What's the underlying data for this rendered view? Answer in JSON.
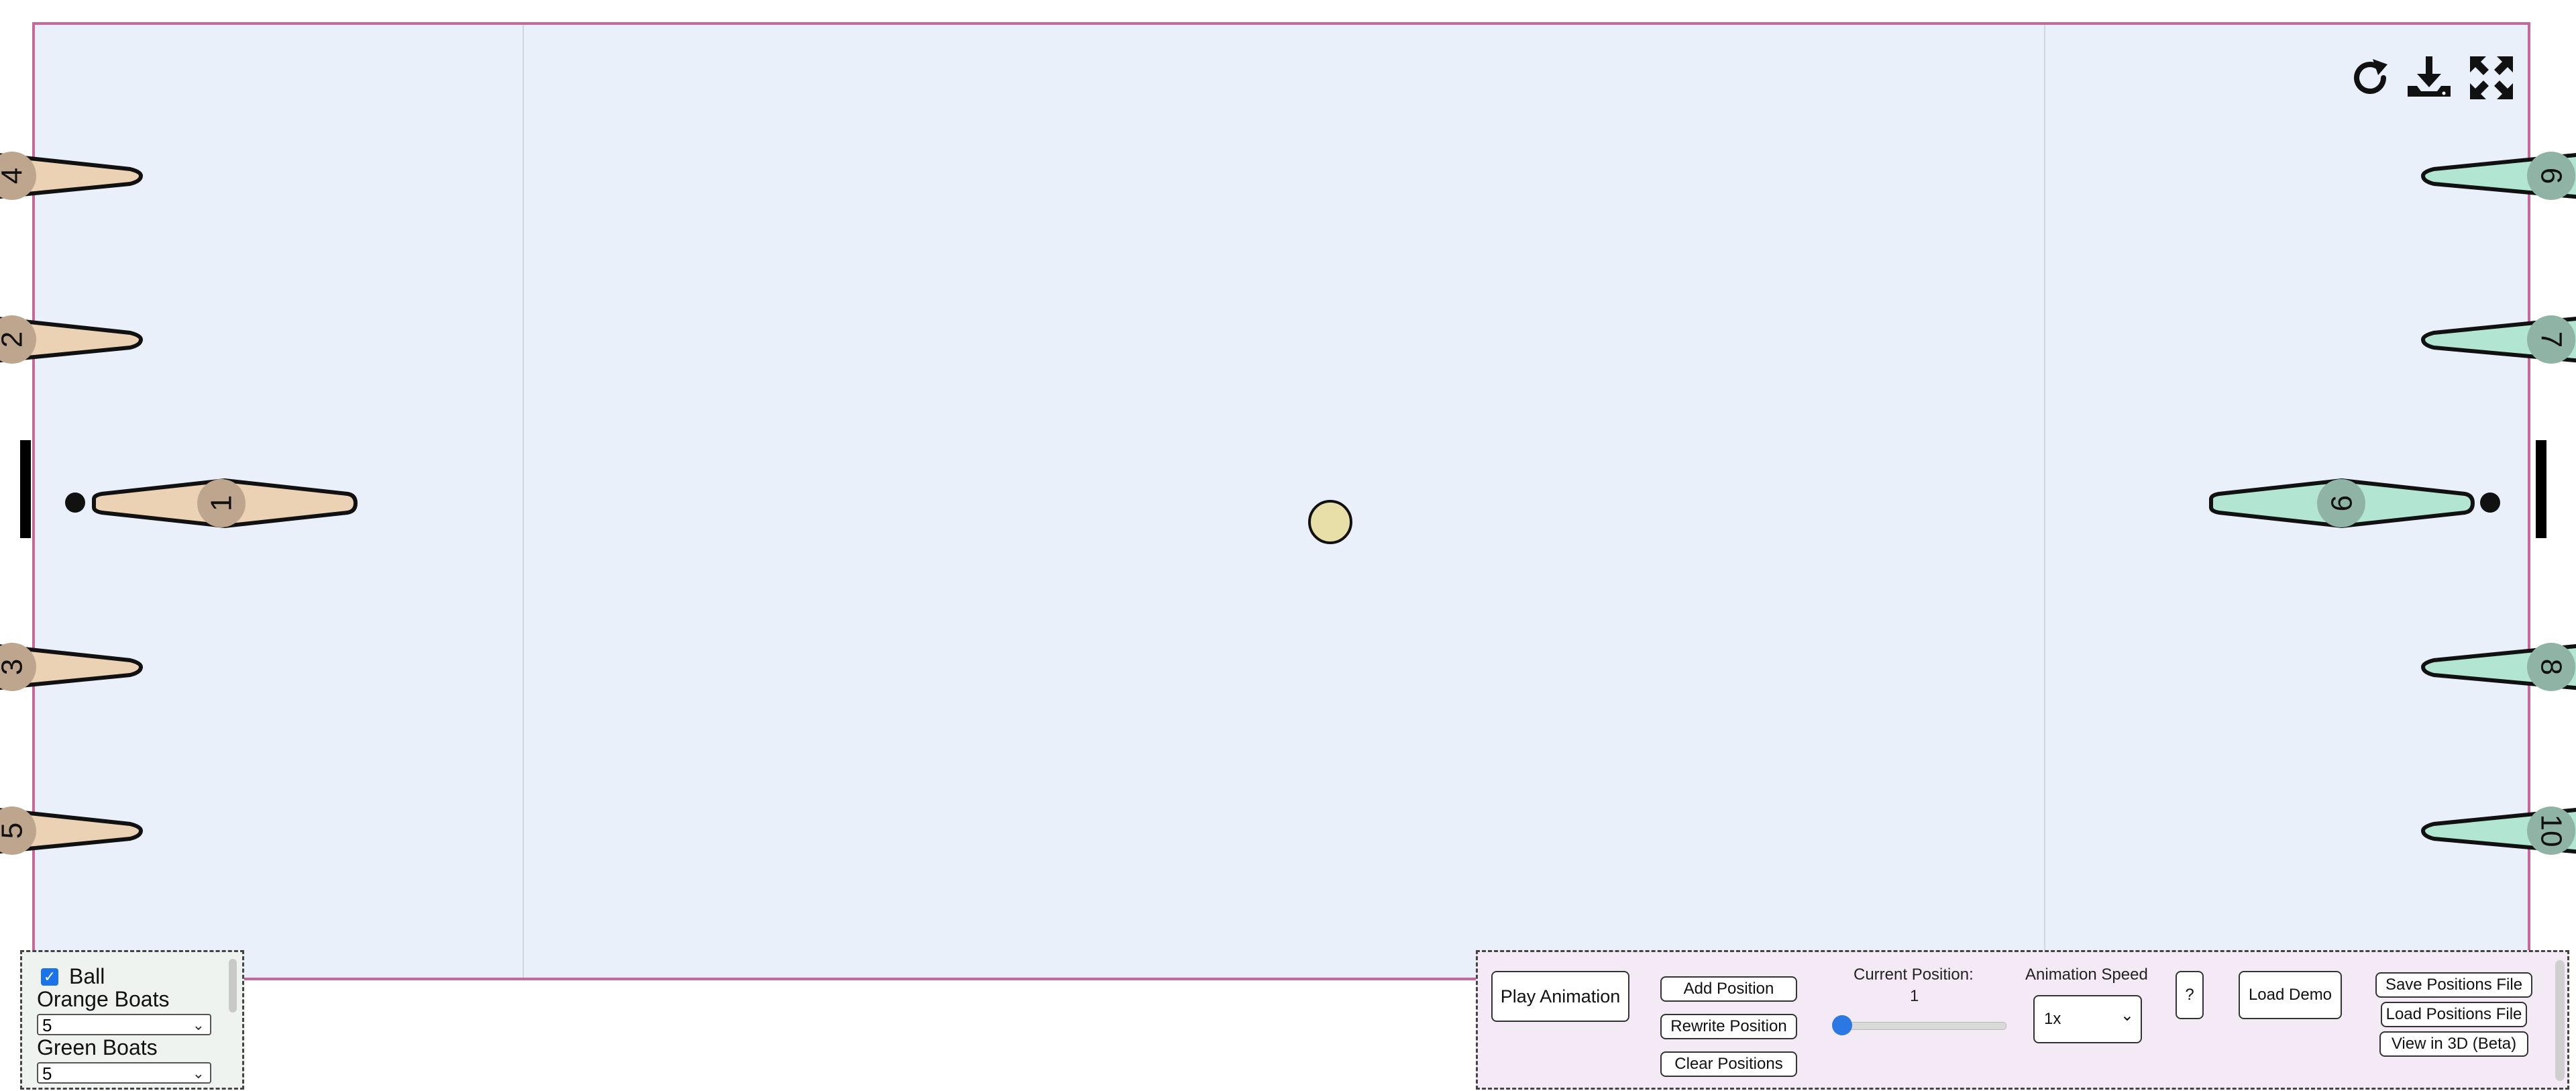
{
  "colors": {
    "field_bg": "#eaf0f9",
    "field_border": "#c8679a",
    "orange_boat": "#ecd2b5",
    "green_boat": "#b2e5d2",
    "orange_badge": "#bea58d",
    "green_badge": "#8fb3a5",
    "ball": "#e8dfa8",
    "slider_accent": "#2b78e4"
  },
  "toolbar_icons": [
    "refresh-icon",
    "download-icon",
    "fullscreen-icon"
  ],
  "boats": {
    "orange": [
      {
        "number": "4"
      },
      {
        "number": "2"
      },
      {
        "number": "1"
      },
      {
        "number": "3"
      },
      {
        "number": "5"
      }
    ],
    "green": [
      {
        "number": "6"
      },
      {
        "number": "7"
      },
      {
        "number": "9"
      },
      {
        "number": "8"
      },
      {
        "number": "10"
      }
    ]
  },
  "settings": {
    "ball_label": "Ball",
    "ball_checked": true,
    "orange_boats_label": "Orange Boats",
    "orange_boats_value": "5",
    "green_boats_label": "Green Boats",
    "green_boats_value": "5"
  },
  "controls": {
    "play_animation": "Play Animation",
    "add_position": "Add Position",
    "rewrite_position": "Rewrite Position",
    "clear_positions": "Clear Positions",
    "current_position_label": "Current Position:",
    "current_position_value": "1",
    "animation_speed_label": "Animation Speed",
    "animation_speed_value": "1x",
    "help": "?",
    "load_demo": "Load Demo",
    "save_positions_file": "Save Positions File",
    "load_positions_file": "Load Positions File",
    "view_in_3d": "View in 3D (Beta)"
  }
}
